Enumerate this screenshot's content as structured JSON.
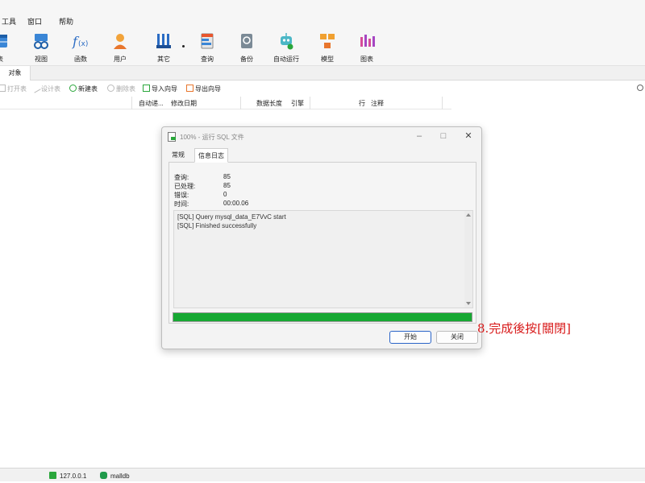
{
  "menu": {
    "items": [
      "工具",
      "窗口",
      "帮助"
    ]
  },
  "ribbon": {
    "tools": [
      {
        "label": "表",
        "icon": "table-icon"
      },
      {
        "label": "视图",
        "icon": "view-icon"
      },
      {
        "label": "函数",
        "icon": "function-icon"
      },
      {
        "label": "用户",
        "icon": "user-icon"
      },
      {
        "label": "其它",
        "icon": "tools-icon"
      },
      {
        "label": "查询",
        "icon": "query-icon"
      },
      {
        "label": "备份",
        "icon": "backup-icon"
      },
      {
        "label": "自动运行",
        "icon": "robot-icon"
      },
      {
        "label": "模型",
        "icon": "model-icon"
      },
      {
        "label": "图表",
        "icon": "chart-icon"
      }
    ]
  },
  "tabs": {
    "object": "对象"
  },
  "toolbar": {
    "open_table": "打开表",
    "design_table": "设计表",
    "new_table": "新建表",
    "delete_table": "删除表",
    "import_wizard": "导入向导",
    "export_wizard": "导出向导"
  },
  "columns": [
    "自动递...",
    "修改日期",
    "数据长度",
    "引擎",
    "行",
    "注释"
  ],
  "dialog": {
    "title": "100% - 运行 SQL 文件",
    "tabs": [
      "常规",
      "信息日志"
    ],
    "stats": [
      {
        "label": "查询:",
        "value": "85"
      },
      {
        "label": "已处理:",
        "value": "85"
      },
      {
        "label": "错误:",
        "value": "0"
      },
      {
        "label": "时间:",
        "value": "00:00.06"
      }
    ],
    "log": [
      "[SQL] Query mysql_data_E7VvC start",
      "[SQL] Finished successfully"
    ],
    "progress": 1.0,
    "start_button": "开始",
    "close_button": "关闭"
  },
  "annotation": "8.完成後按[關閉]",
  "statusbar": {
    "connection": "127.0.0.1",
    "database": "malldb"
  },
  "colors": {
    "progress": "#16a832",
    "annotation": "#d81a1a",
    "accent": "#2a64c8"
  }
}
